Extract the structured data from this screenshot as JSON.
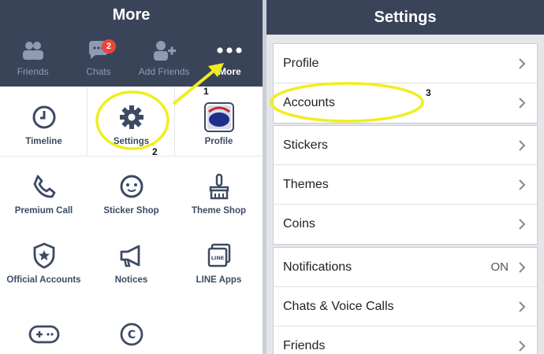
{
  "left": {
    "title": "More",
    "tabs": [
      {
        "label": "Friends",
        "icon": "friends-icon"
      },
      {
        "label": "Chats",
        "icon": "chats-icon",
        "badge": "2"
      },
      {
        "label": "Add Friends",
        "icon": "add-friends-icon"
      },
      {
        "label": "More",
        "icon": "more-dots-icon"
      }
    ],
    "grid": [
      {
        "label": "Timeline",
        "icon": "clock-icon"
      },
      {
        "label": "Settings",
        "icon": "gear-icon"
      },
      {
        "label": "Profile",
        "icon": "profile-avatar-icon"
      },
      {
        "label": "Premium Call",
        "icon": "phone-icon"
      },
      {
        "label": "Sticker Shop",
        "icon": "sticker-face-icon"
      },
      {
        "label": "Theme Shop",
        "icon": "brush-icon"
      },
      {
        "label": "Official Accounts",
        "icon": "shield-star-icon"
      },
      {
        "label": "Notices",
        "icon": "megaphone-icon"
      },
      {
        "label": "LINE Apps",
        "icon": "line-apps-icon"
      },
      {
        "label": "",
        "icon": "gamepad-icon"
      },
      {
        "label": "",
        "icon": "coin-c-icon"
      }
    ],
    "annotations": {
      "n1": "1",
      "n2": "2"
    }
  },
  "right": {
    "title": "Settings",
    "groups": [
      [
        {
          "label": "Profile"
        },
        {
          "label": "Accounts"
        }
      ],
      [
        {
          "label": "Stickers"
        },
        {
          "label": "Themes"
        },
        {
          "label": "Coins"
        }
      ],
      [
        {
          "label": "Notifications",
          "value": "ON"
        },
        {
          "label": "Chats & Voice Calls"
        },
        {
          "label": "Friends"
        }
      ]
    ],
    "annotations": {
      "n3": "3"
    }
  },
  "colors": {
    "header": "#3a4459",
    "highlight": "#f0ee1e",
    "badge": "#e8473a"
  }
}
